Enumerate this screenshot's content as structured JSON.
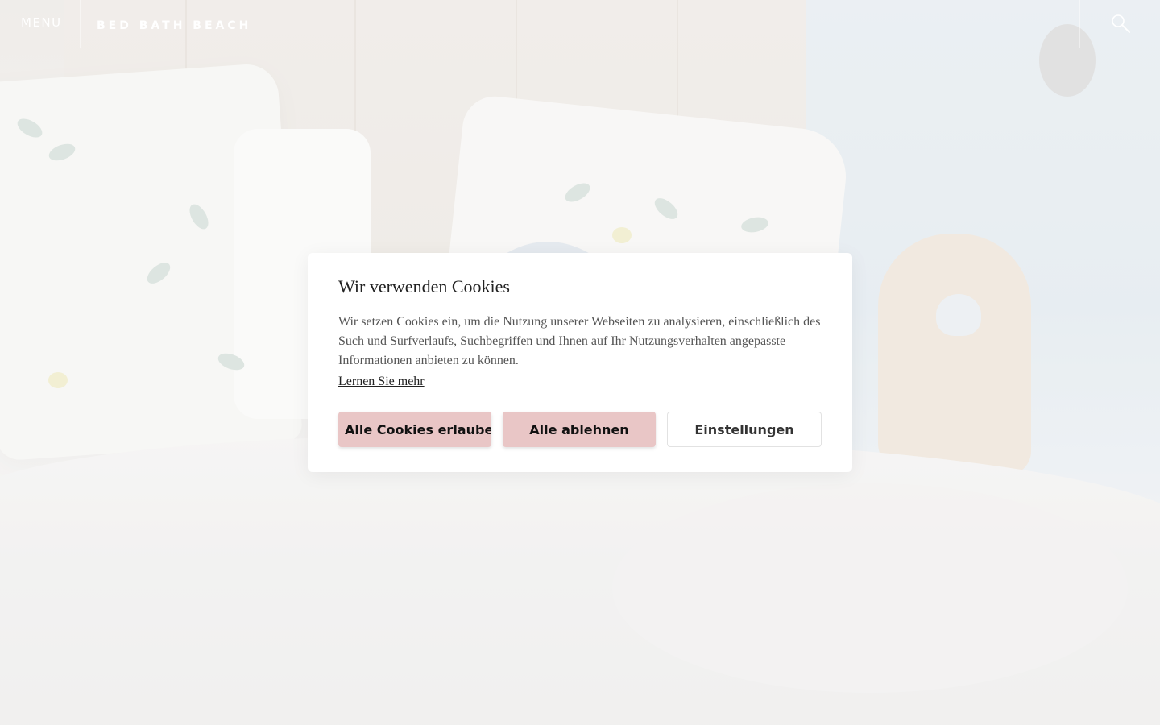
{
  "header": {
    "menu_label": "Menu",
    "site_title": "BED BATH BEACH",
    "search_icon": "search-icon"
  },
  "cookie_dialog": {
    "title": "Wir verwenden Cookies",
    "body": "Wir setzen Cookies ein, um die Nutzung unserer Webseiten zu analysieren, einschließlich des Such und Surfverlaufs, Suchbegriffen und Ihnen auf Ihr Nutzungsverhalten angepasste Informationen anbieten zu können.",
    "learn_more": "Lernen Sie mehr",
    "buttons": {
      "allow_all": "Alle Cookies erlauben",
      "reject_all": "Alle ablehnen",
      "settings": "Einstellungen"
    }
  },
  "colors": {
    "accent_button": "#e9c6c6",
    "header_text": "#ffffff",
    "dialog_bg": "#ffffff"
  }
}
